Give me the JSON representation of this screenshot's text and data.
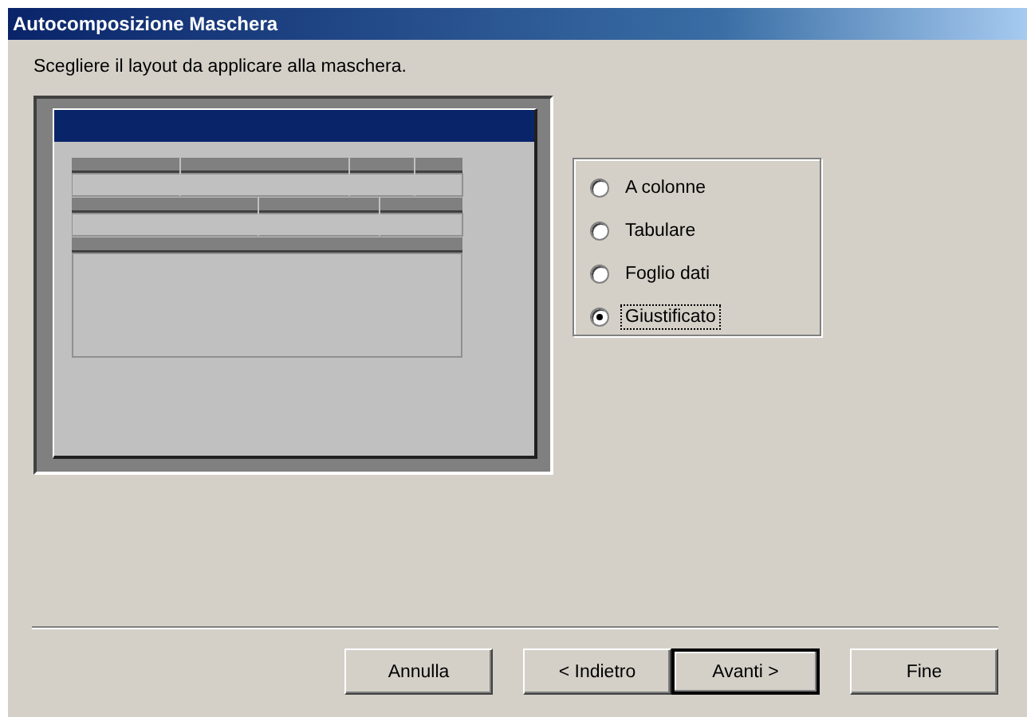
{
  "window": {
    "title": "Autocomposizione Maschera"
  },
  "instruction": "Scegliere il layout da applicare alla maschera.",
  "layout_options": [
    {
      "label": "A colonne",
      "selected": false,
      "focused": false
    },
    {
      "label": "Tabulare",
      "selected": false,
      "focused": false
    },
    {
      "label": "Foglio dati",
      "selected": false,
      "focused": false
    },
    {
      "label": "Giustificato",
      "selected": true,
      "focused": true
    }
  ],
  "buttons": [
    {
      "label": "Annulla",
      "default": false
    },
    {
      "label": "< Indietro",
      "default": false
    },
    {
      "label": "Avanti >",
      "default": true
    },
    {
      "label": "Fine",
      "default": false
    }
  ]
}
